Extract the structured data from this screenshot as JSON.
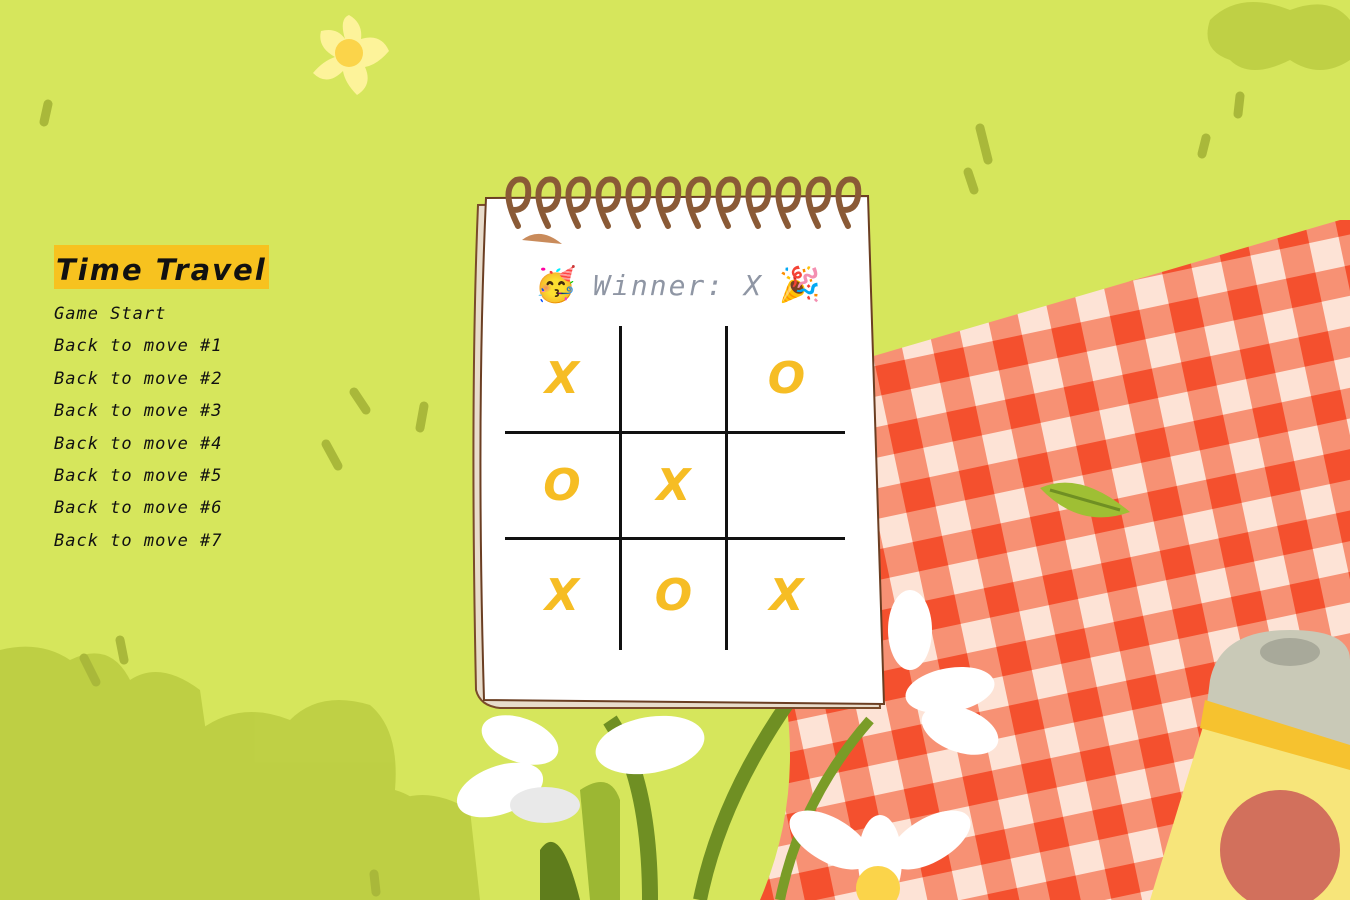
{
  "sidebar": {
    "title": "Time Travel",
    "history": [
      "Game Start",
      "Back to move #1",
      "Back to move #2",
      "Back to move #3",
      "Back to move #4",
      "Back to move #5",
      "Back to move #6",
      "Back to move #7"
    ]
  },
  "status": {
    "left_emoji": "🥳",
    "text": "Winner: X",
    "right_emoji": "🎉"
  },
  "board": {
    "cells": [
      "X",
      "",
      "O",
      "O",
      "X",
      "",
      "X",
      "O",
      "X"
    ]
  },
  "colors": {
    "background": "#d6e65c",
    "highlight": "#f7c21f",
    "mark": "#f6bd24",
    "status_text": "#8f96a4",
    "checker_red": "#f45b38"
  }
}
